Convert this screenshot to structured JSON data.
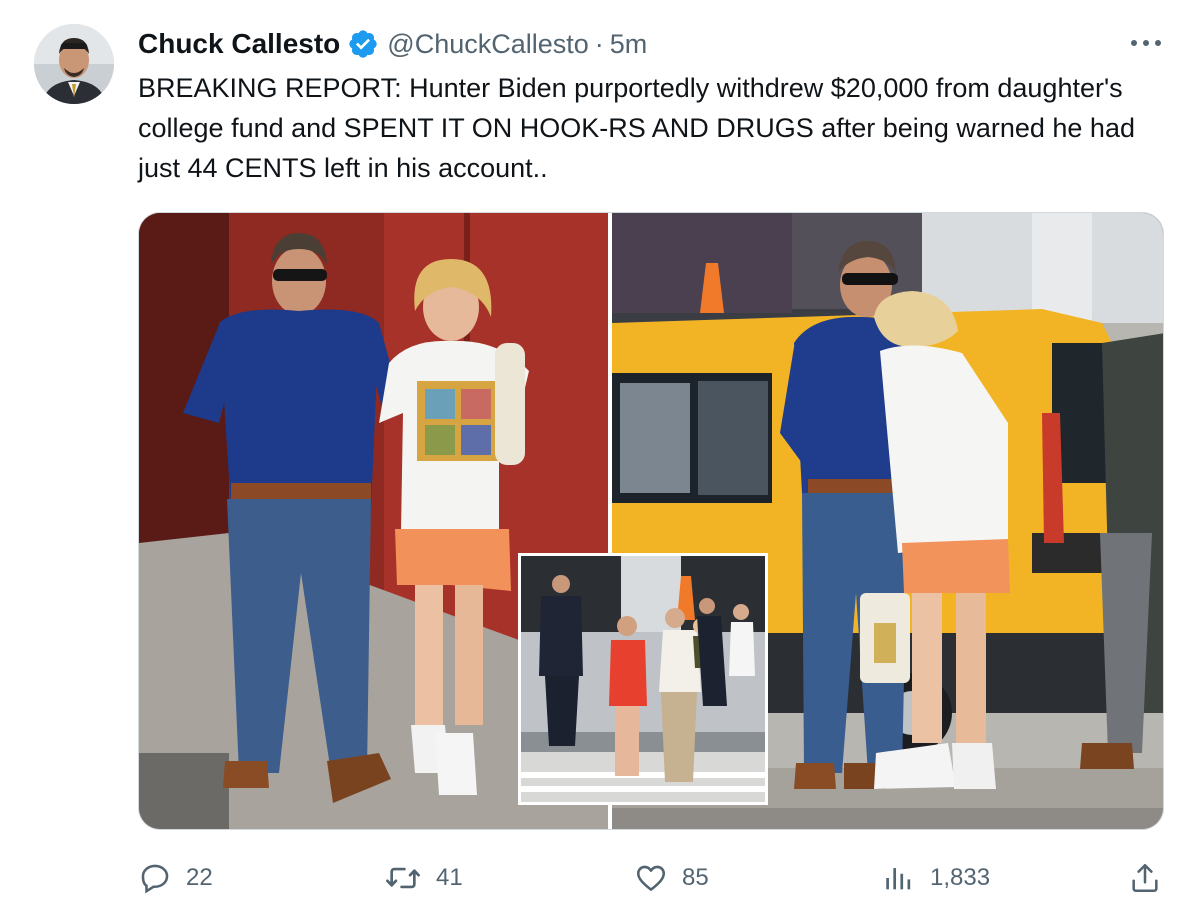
{
  "tweet": {
    "author": {
      "display_name": "Chuck Callesto",
      "handle": "@ChuckCallesto",
      "verified": true,
      "avatar_icon": "profile-photo"
    },
    "separator": "·",
    "timestamp": "5m",
    "more_icon": "more-horizontal-icon",
    "text": "BREAKING REPORT: Hunter Biden purportedly withdrew $20,000 from daughter's college fund and SPENT IT ON HOOK-RS AND DRUGS after being warned he had just 44 CENTS left in his account..",
    "media": {
      "photos": [
        "photo-man-and-daughter-walking",
        "photo-man-and-daughter-by-yellow-taxi",
        "photo-inset-group-crossing-street"
      ]
    },
    "actions": {
      "reply": {
        "icon": "reply-icon",
        "count": "22"
      },
      "retweet": {
        "icon": "retweet-icon",
        "count": "41"
      },
      "like": {
        "icon": "heart-icon",
        "count": "85"
      },
      "views": {
        "icon": "views-icon",
        "count": "1,833"
      },
      "share": {
        "icon": "share-icon"
      }
    }
  },
  "colors": {
    "text_primary": "#0f1419",
    "text_secondary": "#536471",
    "verified_blue": "#1d9bf0",
    "border": "#cfd9de"
  }
}
